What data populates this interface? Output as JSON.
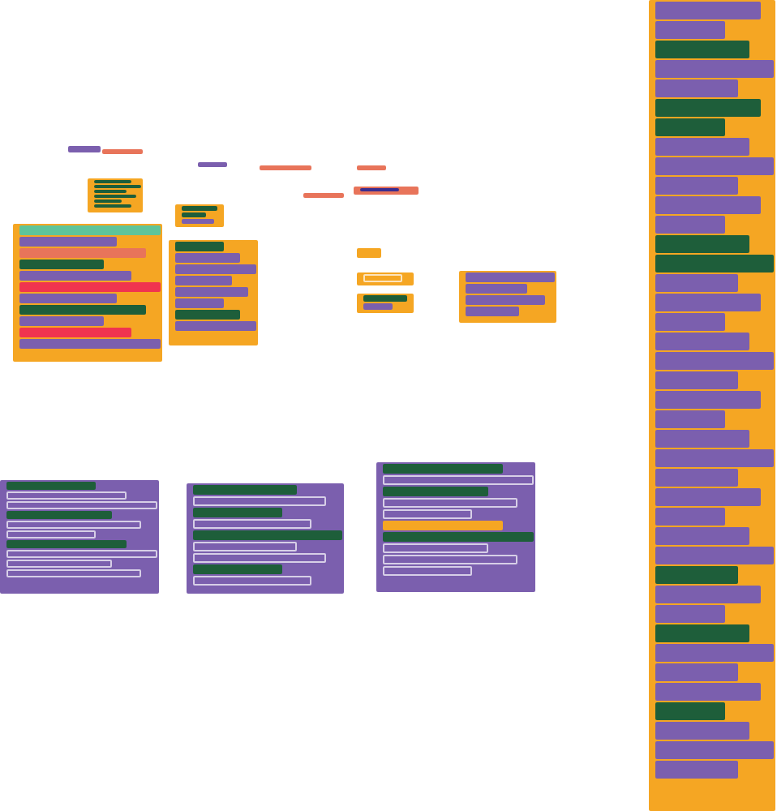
{
  "block_stacks": [
    {
      "color": "#7b5fae"
    },
    {
      "color": "#e8745a"
    },
    {
      "color": "#7b5fae"
    },
    {
      "color": "#e8745a"
    },
    {
      "color": "#e8745a"
    },
    {
      "color": "#e8745a"
    },
    {
      "color": "#e8745a",
      "rows": [
        {
          "color": "#3b2c8f"
        }
      ]
    },
    {
      "color": "#f5a623",
      "rows": [
        {
          "color": "#1e5e3a"
        },
        {
          "color": "#1e5e3a"
        },
        {
          "color": "#1e5e3a"
        },
        {
          "color": "#1e5e3a"
        },
        {
          "color": "#1e5e3a"
        },
        {
          "color": "#1e5e3a"
        }
      ]
    },
    {
      "color": "#f5a623",
      "rows": [
        {
          "color": "#1e5e3a"
        },
        {
          "color": "#1e5e3a"
        },
        {
          "color": "#7b5fae"
        }
      ]
    },
    {
      "color": "#f5a623",
      "rows": [
        {
          "color": "#5ec49a"
        },
        {
          "color": "#7b5fae"
        },
        {
          "color": "#e8745a"
        },
        {
          "color": "#1e5e3a"
        },
        {
          "color": "#7b5fae"
        },
        {
          "color": "#f0344f"
        },
        {
          "color": "#7b5fae"
        },
        {
          "color": "#1e5e3a"
        },
        {
          "color": "#7b5fae"
        },
        {
          "color": "#f0344f"
        },
        {
          "color": "#7b5fae"
        }
      ]
    },
    {
      "color": "#f5a623",
      "rows": [
        {
          "color": "#1e5e3a"
        },
        {
          "color": "#7b5fae"
        },
        {
          "color": "#7b5fae"
        },
        {
          "color": "#7b5fae"
        },
        {
          "color": "#7b5fae"
        },
        {
          "color": "#7b5fae"
        },
        {
          "color": "#1e5e3a"
        },
        {
          "color": "#7b5fae"
        }
      ]
    },
    {
      "color": "#f5a623"
    },
    {
      "color": "#f5a623",
      "rows": [
        {
          "color": "#f5a623"
        }
      ]
    },
    {
      "color": "#f5a623",
      "rows": [
        {
          "color": "#1e5e3a"
        },
        {
          "color": "#7b5fae"
        }
      ]
    },
    {
      "color": "#f5a623",
      "rows": [
        {
          "color": "#7b5fae"
        },
        {
          "color": "#7b5fae"
        },
        {
          "color": "#7b5fae"
        },
        {
          "color": "#7b5fae"
        }
      ]
    },
    {
      "color": "#7b5fae",
      "rows": [
        {
          "color": "#1e5e3a"
        },
        {
          "color": "#7b5fae"
        },
        {
          "color": "#7b5fae"
        },
        {
          "color": "#1e5e3a"
        },
        {
          "color": "#7b5fae"
        },
        {
          "color": "#7b5fae"
        },
        {
          "color": "#1e5e3a"
        },
        {
          "color": "#7b5fae"
        },
        {
          "color": "#7b5fae"
        },
        {
          "color": "#7b5fae"
        }
      ]
    },
    {
      "color": "#7b5fae",
      "rows": [
        {
          "color": "#1e5e3a"
        },
        {
          "color": "#7b5fae"
        },
        {
          "color": "#1e5e3a"
        },
        {
          "color": "#7b5fae"
        },
        {
          "color": "#1e5e3a"
        },
        {
          "color": "#7b5fae"
        },
        {
          "color": "#7b5fae"
        },
        {
          "color": "#1e5e3a"
        },
        {
          "color": "#7b5fae"
        }
      ]
    },
    {
      "color": "#7b5fae",
      "rows": [
        {
          "color": "#1e5e3a"
        },
        {
          "color": "#7b5fae"
        },
        {
          "color": "#1e5e3a"
        },
        {
          "color": "#7b5fae"
        },
        {
          "color": "#7b5fae"
        },
        {
          "color": "#f5a623"
        },
        {
          "color": "#1e5e3a"
        },
        {
          "color": "#7b5fae"
        },
        {
          "color": "#7b5fae"
        },
        {
          "color": "#7b5fae"
        }
      ]
    },
    {
      "color": "#f5a623",
      "rows": [
        {
          "color": "#7b5fae"
        },
        {
          "color": "#7b5fae"
        },
        {
          "color": "#1e5e3a"
        },
        {
          "color": "#7b5fae"
        },
        {
          "color": "#7b5fae"
        },
        {
          "color": "#1e5e3a"
        },
        {
          "color": "#1e5e3a"
        },
        {
          "color": "#7b5fae"
        },
        {
          "color": "#7b5fae"
        },
        {
          "color": "#7b5fae"
        },
        {
          "color": "#7b5fae"
        },
        {
          "color": "#7b5fae"
        },
        {
          "color": "#1e5e3a"
        },
        {
          "color": "#1e5e3a"
        },
        {
          "color": "#7b5fae"
        },
        {
          "color": "#7b5fae"
        },
        {
          "color": "#7b5fae"
        },
        {
          "color": "#7b5fae"
        },
        {
          "color": "#7b5fae"
        },
        {
          "color": "#7b5fae"
        },
        {
          "color": "#7b5fae"
        },
        {
          "color": "#7b5fae"
        },
        {
          "color": "#7b5fae"
        },
        {
          "color": "#7b5fae"
        },
        {
          "color": "#7b5fae"
        },
        {
          "color": "#7b5fae"
        },
        {
          "color": "#7b5fae"
        },
        {
          "color": "#7b5fae"
        },
        {
          "color": "#7b5fae"
        },
        {
          "color": "#1e5e3a"
        },
        {
          "color": "#7b5fae"
        },
        {
          "color": "#7b5fae"
        },
        {
          "color": "#1e5e3a"
        },
        {
          "color": "#7b5fae"
        },
        {
          "color": "#7b5fae"
        },
        {
          "color": "#7b5fae"
        },
        {
          "color": "#1e5e3a"
        },
        {
          "color": "#7b5fae"
        },
        {
          "color": "#7b5fae"
        },
        {
          "color": "#7b5fae"
        }
      ]
    }
  ]
}
